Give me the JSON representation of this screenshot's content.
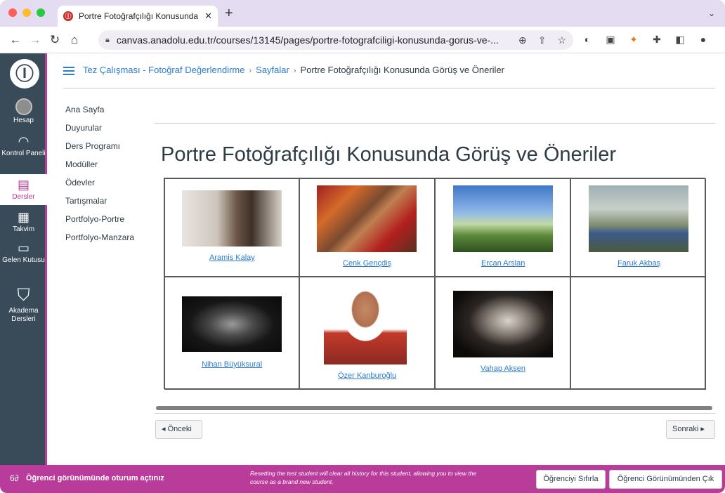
{
  "browser": {
    "tab_title": "Portre Fotoğrafçılığı Konusunda",
    "tab_close": "✕",
    "new_tab": "+",
    "tab_menu": "⌄",
    "url": "canvas.anadolu.edu.tr/courses/13145/pages/portre-fotografciligi-konusunda-gorus-ve-..."
  },
  "globalnav": {
    "logo": "Ⓘ",
    "items": [
      {
        "label": "Hesap",
        "icon": "avatar"
      },
      {
        "label": "Kontrol Paneli",
        "icon": "dashboard-icon"
      },
      {
        "label": "Dersler",
        "icon": "courses-icon"
      },
      {
        "label": "Takvim",
        "icon": "calendar-icon"
      },
      {
        "label": "Gelen Kutusu",
        "icon": "inbox-icon"
      },
      {
        "label": "Akadema Dersleri",
        "icon": "graduation-cap-icon"
      }
    ]
  },
  "breadcrumb": {
    "course": "Tez Çalışması - Fotoğraf Değerlendirme",
    "section": "Sayfalar",
    "current": "Portre Fotoğrafçılığı Konusunda Görüş ve Öneriler"
  },
  "coursenav": [
    "Ana Sayfa",
    "Duyurular",
    "Ders Programı",
    "Modüller",
    "Ödevler",
    "Tartışmalar",
    "Portfolyo-Portre",
    "Portfolyo-Manzara"
  ],
  "page": {
    "title": "Portre Fotoğrafçılığı Konusunda Görüş ve Öneriler",
    "photographers": [
      "Aramis Kalay",
      "Cenk Gençdiş",
      "Ercan Arslan",
      "Faruk Akbaş",
      "Nihan Büyüksural",
      "Özer Kanburoğlu",
      "Vahap Aksen"
    ]
  },
  "pager": {
    "prev": "◂ Önceki",
    "next": "Sonraki ▸"
  },
  "student_view": {
    "message": "Öğrenci görünümünde oturum açtınız",
    "note": "Resetting the test student will clear all history for this student, allowing you to view the course as a brand new student.",
    "reset_button": "Öğrenciyi Sıfırla",
    "leave_button": "Öğrenci Görünümünden Çık"
  },
  "colors": {
    "accent": "#b93b9a",
    "nav_bg": "#394b58",
    "link": "#2d7bd1"
  }
}
